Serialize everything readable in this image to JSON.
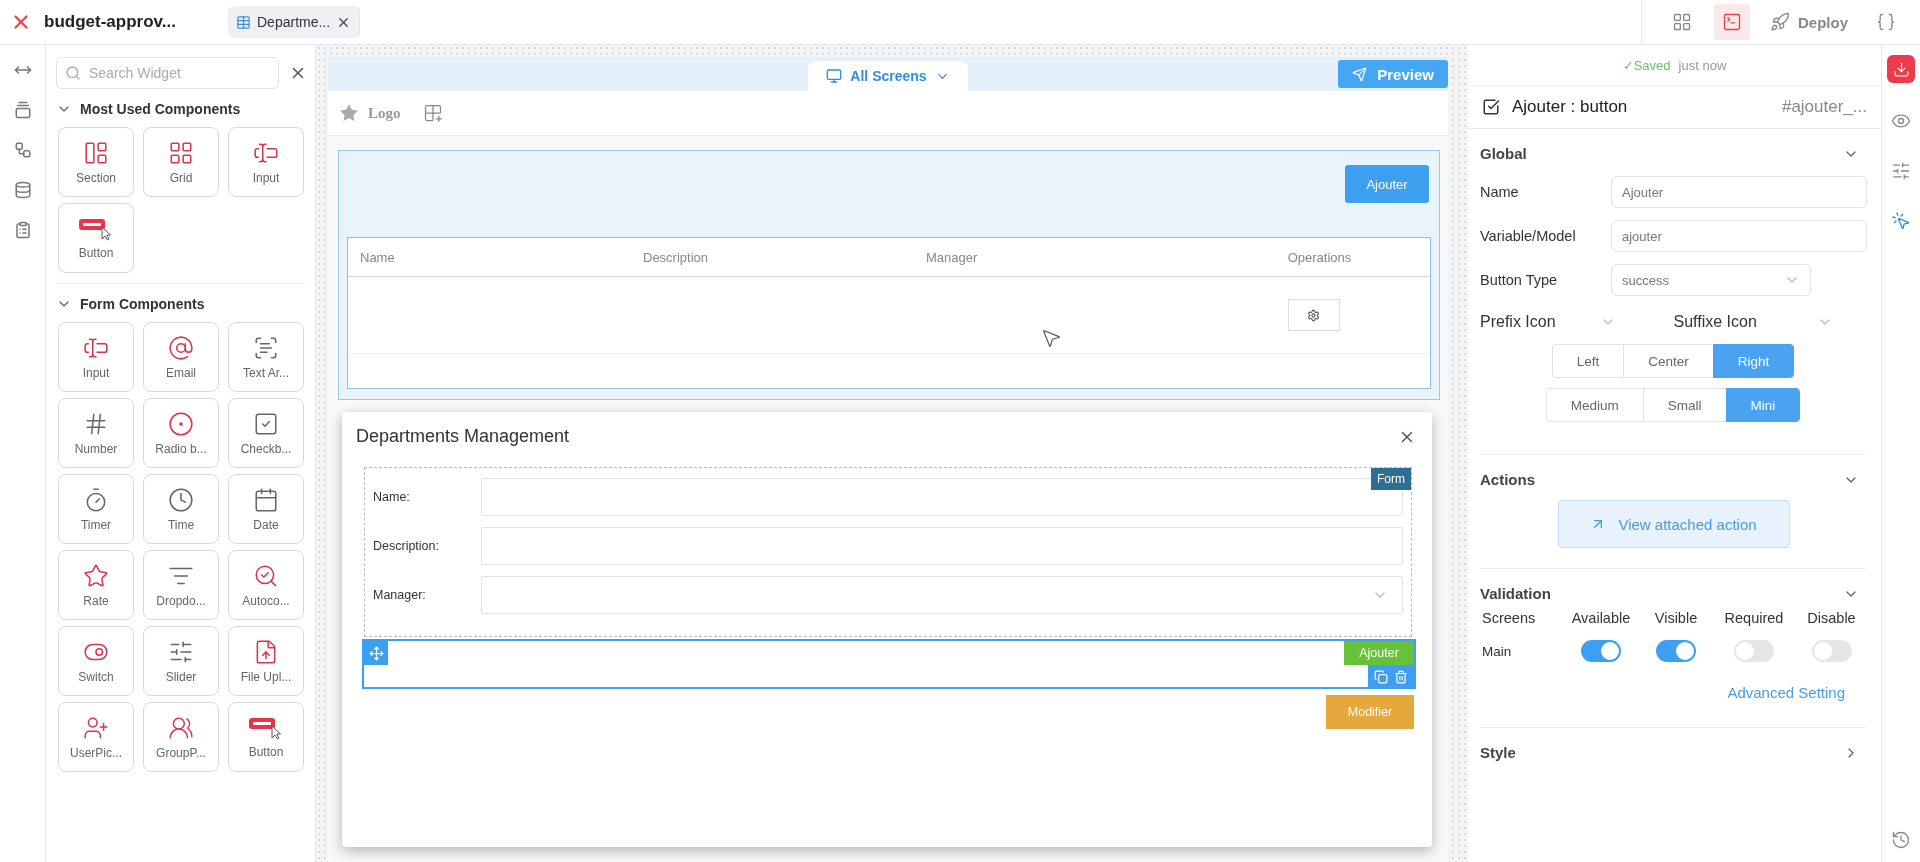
{
  "app": {
    "title": "budget-approv...",
    "tabs": [
      {
        "label": "Departme...",
        "selected": true
      }
    ],
    "tools": [
      {
        "kind": "widgets",
        "selected": false
      },
      {
        "kind": "console",
        "selected": true
      },
      {
        "kind": "deploy",
        "label": "Deploy",
        "selected": false
      },
      {
        "kind": "variables",
        "selected": false
      }
    ]
  },
  "widget_panel": {
    "search": {
      "placeholder": "Search Widget"
    },
    "groups": [
      {
        "title": "Most Used Components",
        "expanded": true,
        "items": [
          {
            "label": "Section"
          },
          {
            "label": "Grid"
          },
          {
            "label": "Input"
          },
          {
            "label": "Button"
          }
        ]
      },
      {
        "title": "Form Components",
        "expanded": true,
        "items": [
          {
            "label": "Input"
          },
          {
            "label": "Email"
          },
          {
            "label": "Text Ar..."
          },
          {
            "label": "Number"
          },
          {
            "label": "Radio b..."
          },
          {
            "label": "Checkb..."
          },
          {
            "label": "Timer"
          },
          {
            "label": "Time"
          },
          {
            "label": "Date"
          },
          {
            "label": "Rate"
          },
          {
            "label": "Dropdo..."
          },
          {
            "label": "Autoco..."
          },
          {
            "label": "Switch"
          },
          {
            "label": "Slider"
          },
          {
            "label": "File Upl..."
          },
          {
            "label": "UserPic..."
          },
          {
            "label": "GroupP..."
          },
          {
            "label": "Button"
          }
        ]
      }
    ]
  },
  "canvas": {
    "screen_selector": "All Screens",
    "preview": "Preview",
    "logo": "Logo",
    "add_button": "Ajouter",
    "table": {
      "columns": [
        "Name",
        "Description",
        "Manager",
        "Operations"
      ]
    }
  },
  "modal": {
    "title": "Departments Management",
    "form_badge": "Form",
    "fields": [
      {
        "label": "Name:",
        "kind": "text"
      },
      {
        "label": "Description:",
        "kind": "text"
      },
      {
        "label": "Manager:",
        "kind": "select"
      }
    ],
    "buttons": [
      {
        "label": "Ajouter",
        "kind": "success",
        "selected": true
      },
      {
        "label": "Modifier",
        "kind": "warning",
        "selected": false
      }
    ]
  },
  "properties": {
    "saved": {
      "status": "✓Saved",
      "time": "just now"
    },
    "header": {
      "checked": true,
      "title": "Ajouter : button",
      "id": "#ajouter_..."
    },
    "global": {
      "title": "Global",
      "expanded": true,
      "fields": [
        {
          "label": "Name",
          "value": "Ajouter",
          "kind": "input"
        },
        {
          "label": "Variable/Model",
          "value": "ajouter",
          "kind": "input"
        },
        {
          "label": "Button Type",
          "value": "success",
          "kind": "select"
        }
      ],
      "icon_selects": [
        {
          "label": "Prefix Icon"
        },
        {
          "label": "Suffixe Icon"
        }
      ],
      "alignment": [
        {
          "label": "Left",
          "selected": false
        },
        {
          "label": "Center",
          "selected": false
        },
        {
          "label": "Right",
          "selected": true
        }
      ],
      "size": [
        {
          "label": "Medium",
          "selected": false
        },
        {
          "label": "Small",
          "selected": false
        },
        {
          "label": "Mini",
          "selected": true
        }
      ]
    },
    "actions": {
      "title": "Actions",
      "expanded": true,
      "link": "View attached action"
    },
    "validation": {
      "title": "Validation",
      "expanded": true,
      "columns": [
        "Screens",
        "Available",
        "Visible",
        "Required",
        "Disable"
      ],
      "rows": [
        {
          "screen": "Main",
          "toggles": [
            {
              "on": true
            },
            {
              "on": true
            },
            {
              "on": false
            },
            {
              "on": false
            }
          ]
        }
      ],
      "advanced": "Advanced Setting"
    },
    "style": {
      "title": "Style",
      "expanded": false
    }
  },
  "right_rail": [
    {
      "kind": "download"
    },
    {
      "kind": "preview",
      "selected": false
    },
    {
      "kind": "settings",
      "selected": false
    },
    {
      "kind": "interactions",
      "selected": true
    },
    {
      "kind": "history",
      "selected": false
    }
  ]
}
